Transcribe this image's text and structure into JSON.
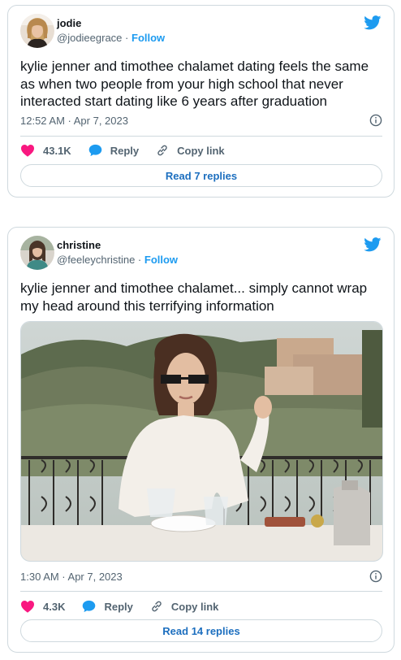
{
  "tweets": [
    {
      "author_name": "jodie",
      "handle": "@jodieegrace",
      "follow_label": "Follow",
      "text": "kylie jenner and timothee chalamet dating feels the same as when two people from your high school that never interacted start dating like 6 years after graduation",
      "timestamp": "12:52 AM · Apr 7, 2023",
      "likes": "43.1K",
      "reply_label": "Reply",
      "copy_link_label": "Copy link",
      "replies_button": "Read 7 replies"
    },
    {
      "author_name": "christine",
      "handle": "@feeleychristine",
      "follow_label": "Follow",
      "text": "kylie jenner and timothee chalamet... simply cannot wrap my head around this terrifying information",
      "timestamp": "1:30 AM · Apr 7, 2023",
      "likes": "4.3K",
      "reply_label": "Reply",
      "copy_link_label": "Copy link",
      "replies_button": "Read 14 replies"
    }
  ],
  "colors": {
    "twitter_blue": "#1d9bf0",
    "like_pink": "#f91880",
    "text_primary": "#0f1419",
    "text_secondary": "#536471",
    "border": "#cfd9de"
  },
  "icons": {
    "brand": "twitter-bird-icon",
    "like": "heart-icon",
    "reply": "speech-bubble-icon",
    "copy_link": "link-icon",
    "info": "info-icon"
  }
}
